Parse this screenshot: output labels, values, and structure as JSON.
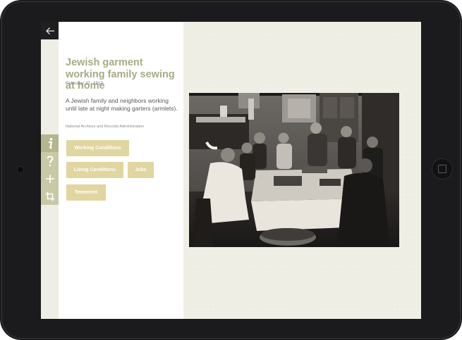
{
  "artifact": {
    "title": "Jewish garment working family sewing at home",
    "date": "February 27, 1912",
    "description": "A Jewish family and neighbors working until late at night making garters (armlets).",
    "source": "National Archives and Records Administration"
  },
  "tags": [
    "Working Conditions",
    "Living Conditions",
    "Jobs",
    "Tenement"
  ],
  "toolbar": {
    "back_icon": "arrow-left-icon",
    "tools": [
      {
        "name": "info",
        "icon": "info-icon",
        "glyph": "i",
        "active": true
      },
      {
        "name": "help",
        "icon": "question-icon",
        "glyph": "?",
        "active": false
      },
      {
        "name": "add",
        "icon": "plus-icon",
        "glyph": "+",
        "active": false
      },
      {
        "name": "crop",
        "icon": "crop-icon",
        "glyph": "",
        "active": false
      }
    ]
  },
  "colors": {
    "accent": "#a8ab85",
    "tag_bg": "#e1d5a0",
    "tool_active": "#b5b68d",
    "tool_inactive": "#c8c9a6",
    "device": "#1b1b1d"
  }
}
